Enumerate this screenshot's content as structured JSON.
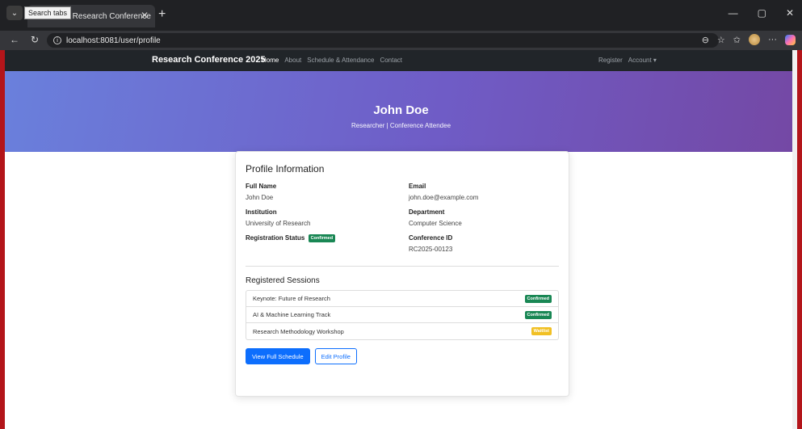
{
  "browser": {
    "tooltip": "Search tabs",
    "tab_title": "file - Research Conference",
    "url": "localhost:8081/user/profile"
  },
  "site": {
    "brand": "Research Conference 2025",
    "nav": [
      "Home",
      "About",
      "Schedule & Attendance",
      "Contact"
    ],
    "register": "Register",
    "account": "Account ▾"
  },
  "hero": {
    "name": "John Doe",
    "subtitle": "Researcher | Conference Attendee"
  },
  "profile": {
    "heading": "Profile Information",
    "full_name_label": "Full Name",
    "full_name": "John Doe",
    "email_label": "Email",
    "email": "john.doe@example.com",
    "institution_label": "Institution",
    "institution": "University of Research",
    "department_label": "Department",
    "department": "Computer Science",
    "status_label": "Registration Status",
    "status": "Confirmed",
    "conf_id_label": "Conference ID",
    "conf_id": "RC2025-00123"
  },
  "sessions": {
    "heading": "Registered Sessions",
    "items": [
      {
        "name": "Keynote: Future of Research",
        "status": "Confirmed"
      },
      {
        "name": "AI & Machine Learning Track",
        "status": "Confirmed"
      },
      {
        "name": "Research Methodology Workshop",
        "status": "Waitlist"
      }
    ]
  },
  "actions": {
    "view_schedule": "View Full Schedule",
    "edit_profile": "Edit Profile"
  },
  "colors": {
    "success": "#198754",
    "warning": "#f1c024",
    "primary": "#0d6efd"
  }
}
